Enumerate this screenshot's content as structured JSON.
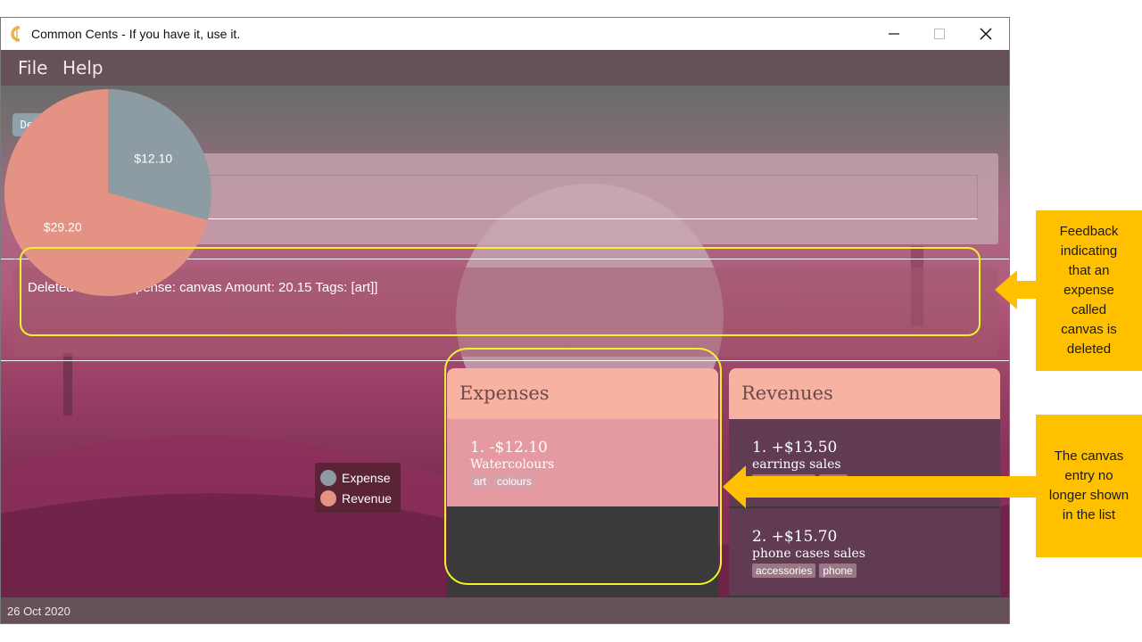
{
  "window": {
    "title": "Common Cents - If you have it, use it.",
    "controls": {
      "minimize": "minimize",
      "maximize": "maximize",
      "close": "close"
    }
  },
  "menu": {
    "file": "File",
    "help": "Help"
  },
  "account": {
    "name": "Default account 1"
  },
  "command": {
    "value": ""
  },
  "result": {
    "message": "Deleted Entry: [Expense: canvas Amount: 20.15 Tags: [art]]"
  },
  "chart_data": {
    "type": "pie",
    "slices": [
      {
        "label": "$12.10",
        "name": "Expense",
        "value": 12.1,
        "color": "#8d9ca3"
      },
      {
        "label": "$29.20",
        "name": "Revenue",
        "value": 29.2,
        "color": "#e39283"
      }
    ],
    "legend": [
      "Expense",
      "Revenue"
    ],
    "legend_position": "right"
  },
  "expenses": {
    "title": "Expenses",
    "items": [
      {
        "amount": "1.  -$12.10",
        "description": "Watercolours",
        "tags": [
          "art",
          "colours"
        ]
      }
    ]
  },
  "revenues": {
    "title": "Revenues",
    "items": [
      {
        "amount": "1.  +$13.50",
        "description": "earrings sales",
        "tags": [
          "accessories",
          "craft"
        ]
      },
      {
        "amount": "2.  +$15.70",
        "description": "phone cases sales",
        "tags": [
          "accessories",
          "phone"
        ]
      }
    ]
  },
  "status": {
    "date": "26 Oct 2020"
  },
  "annotations": {
    "feedback_callout": [
      "Feedback",
      "indicating",
      "that an",
      "expense",
      "called",
      "canvas is",
      "deleted"
    ],
    "list_callout": [
      "The canvas",
      "entry no",
      "longer shown",
      "in the list"
    ]
  },
  "colors": {
    "highlight": "#f3f32b",
    "callout": "#ffc000",
    "accent": "#f7b2a2"
  }
}
